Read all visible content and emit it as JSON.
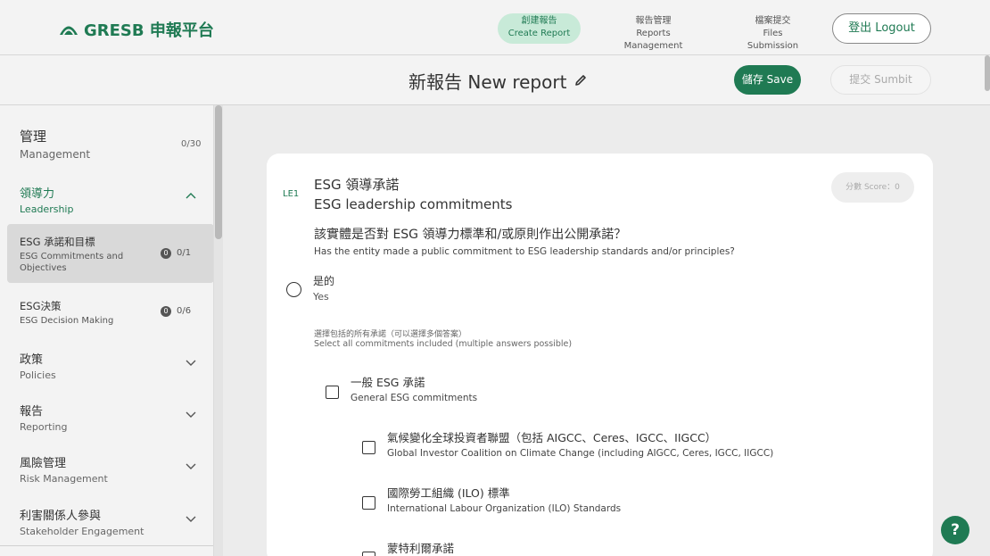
{
  "app": {
    "brand": "GRESB 申報平台"
  },
  "nav": [
    {
      "zh": "創建報告",
      "en": "Create Report"
    },
    {
      "zh": "報告管理",
      "en": "Reports Management"
    },
    {
      "zh": "檔案提交",
      "en": "Files Submission"
    }
  ],
  "logout_label": "登出 Logout",
  "report": {
    "title": "新報告 New report",
    "save_label": "儲存 Save",
    "submit_label": "提交 Sumbit"
  },
  "sidebar": {
    "management": {
      "zh": "管理",
      "en": "Management",
      "count": "0/30"
    },
    "leadership": {
      "zh": "領導力",
      "en": "Leadership"
    },
    "subitems": [
      {
        "zh": "ESG 承諾和目標",
        "en1": "ESG Commitments and",
        "en2": "Objectives",
        "badge": "0",
        "frac": "0/1"
      },
      {
        "zh": "ESG決策",
        "en1": "ESG Decision Making",
        "en2": "",
        "badge": "0",
        "frac": "0/6"
      }
    ],
    "sections": [
      {
        "zh": "政策",
        "en": "Policies"
      },
      {
        "zh": "報告",
        "en": "Reporting"
      },
      {
        "zh": "風險管理",
        "en": "Risk Management"
      },
      {
        "zh": "利害關係人參與",
        "en": "Stakeholder Engagement"
      }
    ]
  },
  "question": {
    "id": "LE1",
    "title_zh": "ESG 領導承諾",
    "title_en": "ESG leadership commitments",
    "score": "分數 Score：0",
    "text_zh": "該實體是否對 ESG 領導力標準和/或原則作出公開承諾？",
    "text_en": "Has the entity made a public commitment to ESG leadership standards and/or principles?",
    "yes_zh": "是的",
    "yes_en": "Yes",
    "hint_zh": "選擇包括的所有承諾（可以選擇多個答案）",
    "hint_en": "Select all commitments included (multiple answers possible)",
    "general": {
      "zh": "一般 ESG 承諾",
      "en": "General ESG commitments"
    },
    "options": [
      {
        "zh": "氣候變化全球投資者聯盟（包括 AIGCC、Ceres、IGCC、IIGCC）",
        "en": "Global Investor Coalition on Climate Change (including AIGCC, Ceres, IGCC, IIGCC)"
      },
      {
        "zh": "國際勞工組織 (ILO) 標準",
        "en": "International Labour Organization (ILO) Standards"
      },
      {
        "zh": "蒙特利爾承諾",
        "en": ""
      }
    ]
  },
  "help_label": "?"
}
